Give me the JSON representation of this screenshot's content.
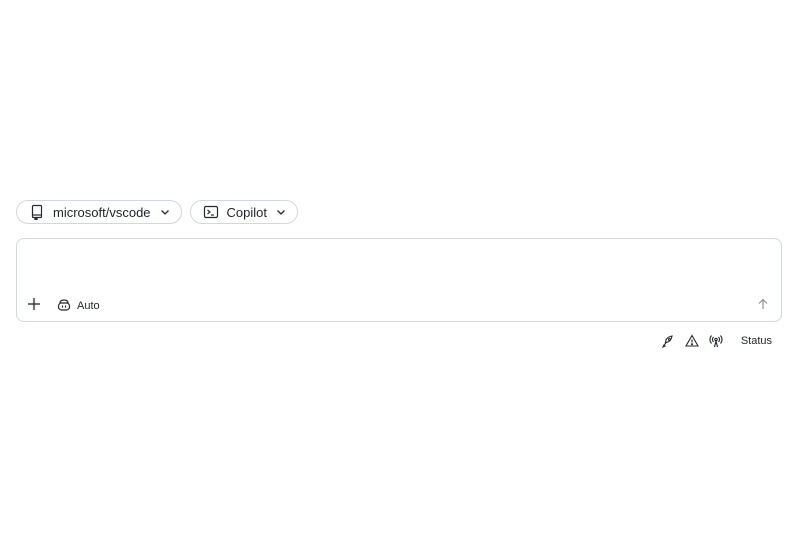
{
  "repo_picker": {
    "label": "microsoft/vscode",
    "icon": "repo-icon"
  },
  "agent_picker": {
    "label": "Copilot",
    "icon": "terminal-icon"
  },
  "composer": {
    "placeholder": "",
    "value": "",
    "model_label": "Auto",
    "add_icon": "plus-icon",
    "model_icon": "copilot-icon",
    "send_icon": "arrow-up-icon"
  },
  "footer": {
    "icons": [
      "debug-icon",
      "alert-icon",
      "broadcast-icon"
    ],
    "status_label": "Status"
  },
  "colors": {
    "border": "#d0d7de",
    "text": "#1f2328",
    "muted": "#8c959f",
    "background": "#ffffff"
  }
}
